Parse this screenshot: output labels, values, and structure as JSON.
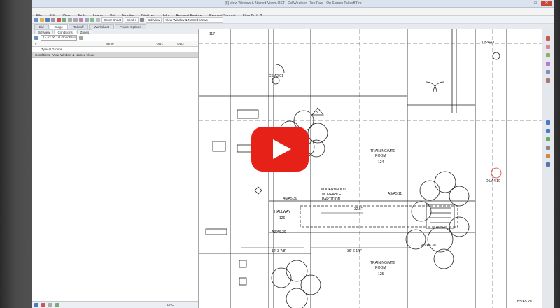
{
  "window": {
    "title": "[8] View Window & Named Views.OST - Gd Weather - Ton Paid - On Screen Takeoff Pro",
    "min": "–",
    "max": "□",
    "close": "✕"
  },
  "menu": [
    "File",
    "Edit",
    "View",
    "Tools",
    "Image",
    "Bid",
    "Monitor",
    "Digitizer",
    "Help",
    "Request Feature",
    "Request Support",
    "How Do I...?"
  ],
  "toolbar1": {
    "cover_sheet": "Cover Sheet",
    "send": "Send ▾",
    "bid_view": "Bid View",
    "named_view": "View Window & Named Views"
  },
  "toolbar2": {
    "page_select": "1 - A2.00 1st Floor Plan.tif",
    "zoom": "1/8\" = 1'-0\"",
    "area": "Area (4x4 Areas)",
    "type_text": "Type text",
    "letter": "Letter"
  },
  "main_tabs": [
    "Bid",
    "Image",
    "Takeoff",
    "Worksheet",
    "Project Options"
  ],
  "active_tab": "Image",
  "left_panel": {
    "tabs": [
      "Bid View",
      "Conditions",
      "Zones"
    ],
    "active": "Conditions",
    "page_select": "1 - A2.00 1st Floor Plan",
    "columns": [
      "#",
      "Name",
      "Qty1",
      "Qty2"
    ],
    "group": "Typical Groups",
    "condition_row": "Conditions - View Window & Named Views",
    "bottom_label": "DPC"
  },
  "drawing": {
    "labels": {
      "room1": "TRAINING/MTG",
      "room1_no": "ROOM",
      "room1_num": "124",
      "room2": "TRAINING/MTG",
      "room2_no": "ROOM",
      "room2_num": "125",
      "hallway": "HALLWAY",
      "hallway_num": "126",
      "partition1": "MODERNFOLD",
      "partition2": "MOVEABLE",
      "partition3": "PARTITION",
      "ref1": "A6/A5.30",
      "ref2": "A3/A6.20",
      "ref3": "A3/A5.11",
      "ref4": "A5/A5.30",
      "ref5": "C6/A2.01",
      "ref6": "D5/A4.11",
      "ref7": "D5/A4.10",
      "ref8": "B5/A5.20",
      "dim1": "32.5\"",
      "dim2": "12'-3 7/8\"",
      "dim3": "36'-6 1/8\"",
      "tag1": "117",
      "tag2": "3"
    }
  },
  "video_overlay": {
    "icon": "play-icon",
    "color": "#e62117"
  },
  "colors": {
    "accent": "#e62117",
    "selected_row": "#d6d6d6"
  }
}
